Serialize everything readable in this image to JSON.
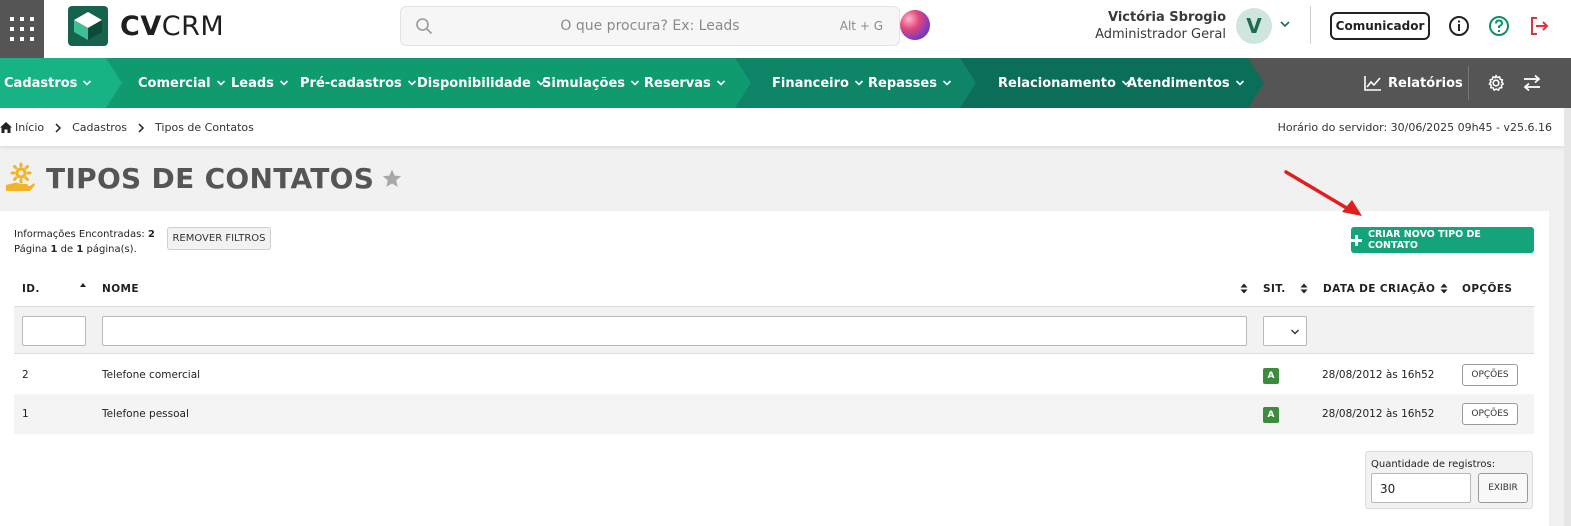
{
  "app": {
    "logo_text_bold": "CV",
    "logo_text_light": "CRM"
  },
  "search": {
    "placeholder": "O que procura? Ex: Leads",
    "shortcut": "Alt + G"
  },
  "user": {
    "name": "Victória Sbrogio",
    "role": "Administrador Geral",
    "avatar_initial": "V"
  },
  "header": {
    "comunicador_label": "Comunicador"
  },
  "nav": {
    "items": [
      {
        "label": "Cadastros"
      },
      {
        "label": "Comercial"
      },
      {
        "label": "Leads"
      },
      {
        "label": "Pré-cadastros"
      },
      {
        "label": "Disponibilidade"
      },
      {
        "label": "Simulações"
      },
      {
        "label": "Reservas"
      },
      {
        "label": "Financeiro"
      },
      {
        "label": "Repasses"
      },
      {
        "label": "Relacionamento"
      },
      {
        "label": "Atendimentos"
      }
    ],
    "reports_label": "Relatórios",
    "colors": {
      "primary_green": "#18b384",
      "mid_green": "#0f9a70",
      "dark_green": "#0b6e58",
      "gray": "#555555"
    }
  },
  "breadcrumb": {
    "items": [
      "Início",
      "Cadastros",
      "Tipos de Contatos"
    ],
    "server_time": "Horário do servidor: 30/06/2025 09h45 - v25.6.16"
  },
  "page": {
    "title": "TIPOS DE CONTATOS"
  },
  "listing": {
    "info_found_label": "Informações Encontradas:",
    "info_found_count": "2",
    "page_word": "Página",
    "page_current": "1",
    "page_of": "de",
    "page_total": "1",
    "page_suffix": "página(s).",
    "remove_filters_label": "REMOVER FILTROS",
    "create_button_label": "CRIAR NOVO TIPO DE CONTATO"
  },
  "table": {
    "columns": [
      "ID.",
      "NOME",
      "SIT.",
      "DATA DE CRIAÇÃO",
      "OPÇÕES"
    ],
    "rows": [
      {
        "id": "2",
        "name": "Telefone comercial",
        "status": "A",
        "created": "28/08/2012 às 16h52",
        "options": "OPÇÕES"
      },
      {
        "id": "1",
        "name": "Telefone pessoal",
        "status": "A",
        "created": "28/08/2012 às 16h52",
        "options": "OPÇÕES"
      }
    ]
  },
  "pagination": {
    "qty_label": "Quantidade de registros:",
    "qty_value": "30",
    "show_button_label": "EXIBIR"
  }
}
